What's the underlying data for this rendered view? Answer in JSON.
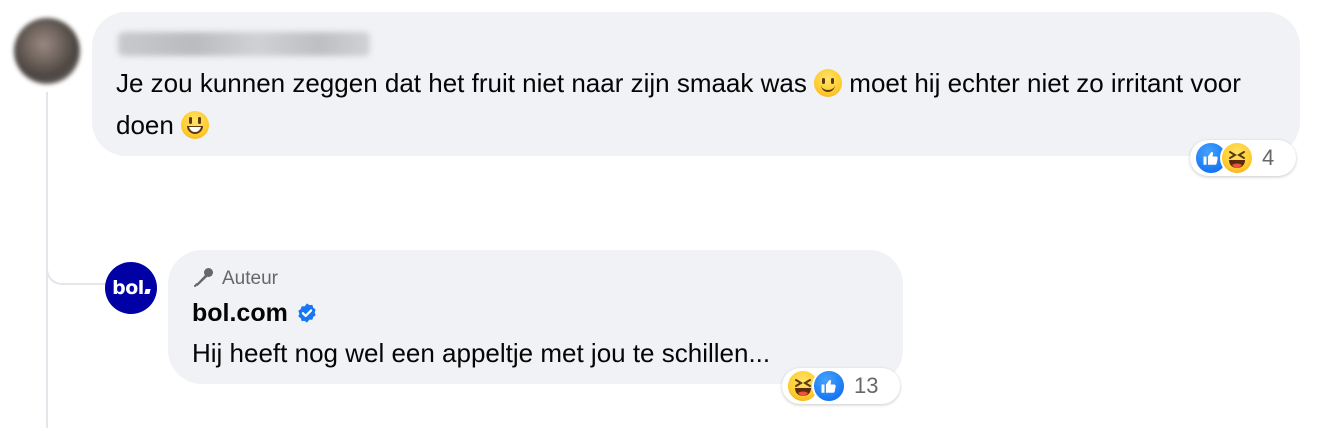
{
  "comment": {
    "author_name_blurred": "",
    "text_part1": "Je zou kunnen zeggen dat het fruit niet naar zijn smaak was ",
    "emoji_1": "slightly-smiling-face",
    "text_part2": " moet hij echter niet zo irritant voor doen ",
    "emoji_2": "grinning-face",
    "reactions": {
      "icons": [
        "like",
        "haha"
      ],
      "count": "4"
    }
  },
  "reply": {
    "badge_label": "Auteur",
    "badge_icon": "microphone-icon",
    "avatar_text": "bol",
    "author_name": "bol.com",
    "verified": true,
    "text": "Hij heeft nog wel een appeltje met jou te schillen...",
    "reactions": {
      "icons": [
        "haha",
        "like"
      ],
      "count": "13"
    }
  },
  "colors": {
    "bubble_bg": "#f0f2f5",
    "secondary_text": "#65676b",
    "like_blue": "#1877f2",
    "brand_blue": "#0000a4",
    "thread_line": "#e4e6eb"
  }
}
